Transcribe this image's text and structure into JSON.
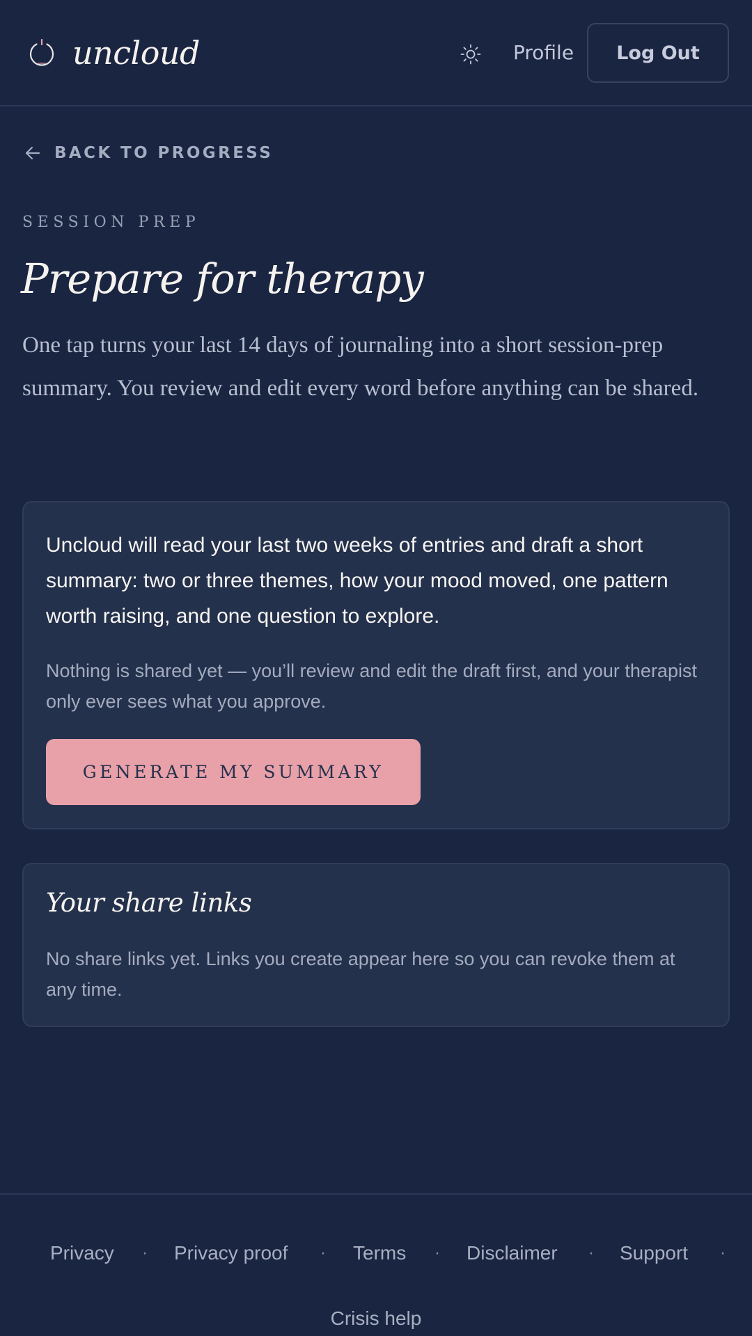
{
  "header": {
    "brand": "uncloud",
    "logo_icon": "power-ring-icon",
    "theme_icon": "sun-icon",
    "profile_label": "Profile",
    "logout_label": "Log Out"
  },
  "back_link": {
    "icon": "arrow-left-icon",
    "label": "BACK TO PROGRESS"
  },
  "hero": {
    "eyebrow": "SESSION PREP",
    "title": "Prepare for therapy",
    "intro": "One tap turns your last 14 days of journaling into a short session-prep summary. You review and edit every word before anything can be shared."
  },
  "generate_card": {
    "lead": "Uncloud will read your last two weeks of entries and draft a short summary: two or three themes, how your mood moved, one pattern worth raising, and one question to explore.",
    "note": "Nothing is shared yet — you’ll review and edit the draft first, and your therapist only ever sees what you approve.",
    "button_label": "GENERATE MY SUMMARY"
  },
  "share_links_card": {
    "title": "Your share links",
    "empty_text": "No share links yet. Links you create appear here so you can revoke them at any time."
  },
  "footer": {
    "links": [
      "Privacy",
      "Privacy proof",
      "Terms",
      "Disclaimer",
      "Support"
    ],
    "separator": "·",
    "crisis_label": "Crisis help"
  },
  "colors": {
    "background": "#1a2542",
    "card": "#24314c",
    "accent_pink": "#e8a1a8",
    "logo_dot": "#e8a1a8"
  }
}
